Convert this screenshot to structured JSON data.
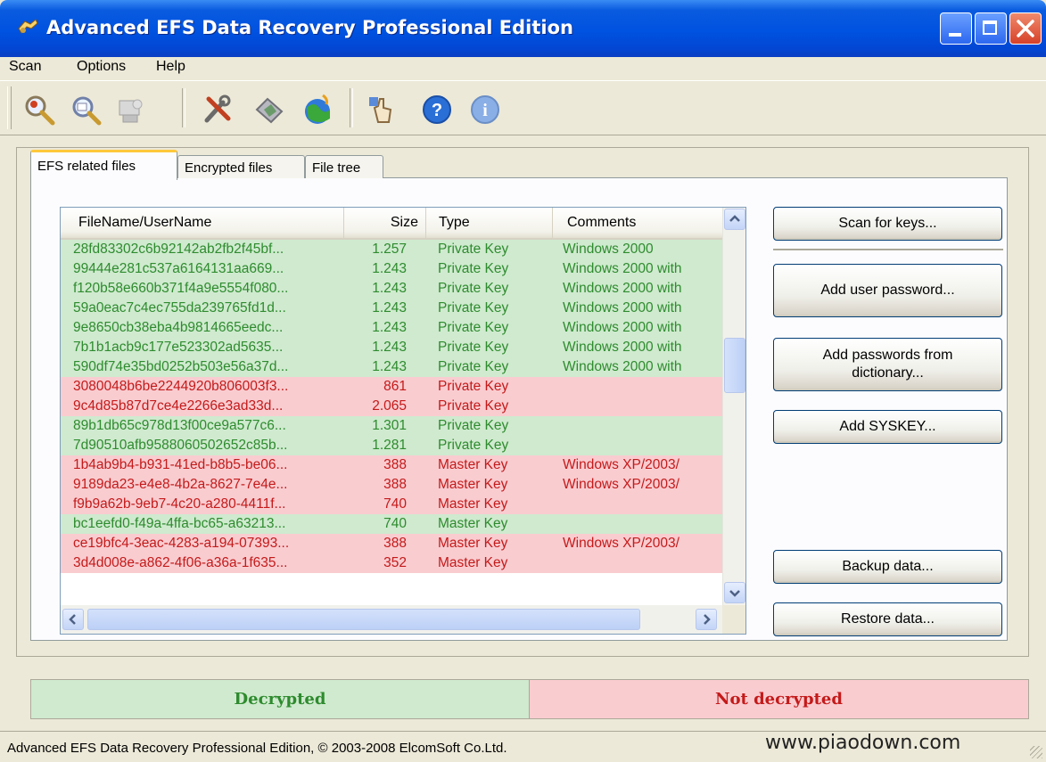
{
  "window": {
    "title": "Advanced EFS Data Recovery Professional Edition"
  },
  "menu": {
    "scan": "Scan",
    "options": "Options",
    "help": "Help"
  },
  "toolbar": {
    "icons": [
      "scan-disk-icon",
      "search-icon",
      "scan-keys-icon",
      "tools-icon",
      "settings-icon",
      "internet-icon",
      "pointer-icon",
      "help-icon",
      "info-icon"
    ]
  },
  "tabs": [
    {
      "label": "EFS related files",
      "active": true
    },
    {
      "label": "Encrypted files",
      "active": false
    },
    {
      "label": "File tree",
      "active": false
    }
  ],
  "table": {
    "columns": [
      "FileName/UserName",
      "Size",
      "Type",
      "Comments"
    ],
    "rows": [
      {
        "name": "28fd83302c6b92142ab2fb2f45bf...",
        "size": "1.257",
        "type": "Private Key",
        "comment": "Windows 2000",
        "status": "green"
      },
      {
        "name": "99444e281c537a6164131aa669...",
        "size": "1.243",
        "type": "Private Key",
        "comment": "Windows 2000 with",
        "status": "green"
      },
      {
        "name": "f120b58e660b371f4a9e5554f080...",
        "size": "1.243",
        "type": "Private Key",
        "comment": "Windows 2000 with",
        "status": "green"
      },
      {
        "name": "59a0eac7c4ec755da239765fd1d...",
        "size": "1.243",
        "type": "Private Key",
        "comment": "Windows 2000 with",
        "status": "green"
      },
      {
        "name": "9e8650cb38eba4b9814665eedc...",
        "size": "1.243",
        "type": "Private Key",
        "comment": "Windows 2000 with",
        "status": "green"
      },
      {
        "name": "7b1b1acb9c177e523302ad5635...",
        "size": "1.243",
        "type": "Private Key",
        "comment": "Windows 2000 with",
        "status": "green"
      },
      {
        "name": "590df74e35bd0252b503e56a37d...",
        "size": "1.243",
        "type": "Private Key",
        "comment": "Windows 2000 with",
        "status": "green"
      },
      {
        "name": "3080048b6be2244920b806003f3...",
        "size": "861",
        "type": "Private Key",
        "comment": "",
        "status": "red"
      },
      {
        "name": "9c4d85b87d7ce4e2266e3ad33d...",
        "size": "2.065",
        "type": "Private Key",
        "comment": "",
        "status": "red"
      },
      {
        "name": "89b1db65c978d13f00ce9a577c6...",
        "size": "1.301",
        "type": "Private Key",
        "comment": "",
        "status": "green"
      },
      {
        "name": "7d90510afb9588060502652c85b...",
        "size": "1.281",
        "type": "Private Key",
        "comment": "",
        "status": "green"
      },
      {
        "name": "1b4ab9b4-b931-41ed-b8b5-be06...",
        "size": "388",
        "type": "Master Key",
        "comment": "Windows XP/2003/",
        "status": "red"
      },
      {
        "name": "9189da23-e4e8-4b2a-8627-7e4e...",
        "size": "388",
        "type": "Master Key",
        "comment": "Windows XP/2003/",
        "status": "red"
      },
      {
        "name": "f9b9a62b-9eb7-4c20-a280-4411f...",
        "size": "740",
        "type": "Master Key",
        "comment": "",
        "status": "red"
      },
      {
        "name": "bc1eefd0-f49a-4ffa-bc65-a63213...",
        "size": "740",
        "type": "Master Key",
        "comment": "",
        "status": "green"
      },
      {
        "name": "ce19bfc4-3eac-4283-a194-07393...",
        "size": "388",
        "type": "Master Key",
        "comment": "Windows XP/2003/",
        "status": "red"
      },
      {
        "name": "3d4d008e-a862-4f06-a36a-1f635...",
        "size": "352",
        "type": "Master Key",
        "comment": "",
        "status": "red"
      }
    ]
  },
  "buttons": {
    "scan_keys": "Scan for keys...",
    "add_user_password": "Add user password...",
    "add_passwords_dictionary": "Add passwords from dictionary...",
    "add_syskey": "Add SYSKEY...",
    "backup": "Backup data...",
    "restore": "Restore data..."
  },
  "legend": {
    "decrypted": "Decrypted",
    "not_decrypted": "Not decrypted"
  },
  "status": {
    "text": "Advanced EFS Data Recovery Professional Edition, © 2003-2008 ElcomSoft Co.Ltd.",
    "watermark": "www.piaodown.com"
  },
  "colors": {
    "decrypted_bg": "#cfeacf",
    "decrypted_text": "#2e8b2e",
    "not_decrypted_bg": "#f9ccd0",
    "not_decrypted_text": "#c41a1a"
  }
}
